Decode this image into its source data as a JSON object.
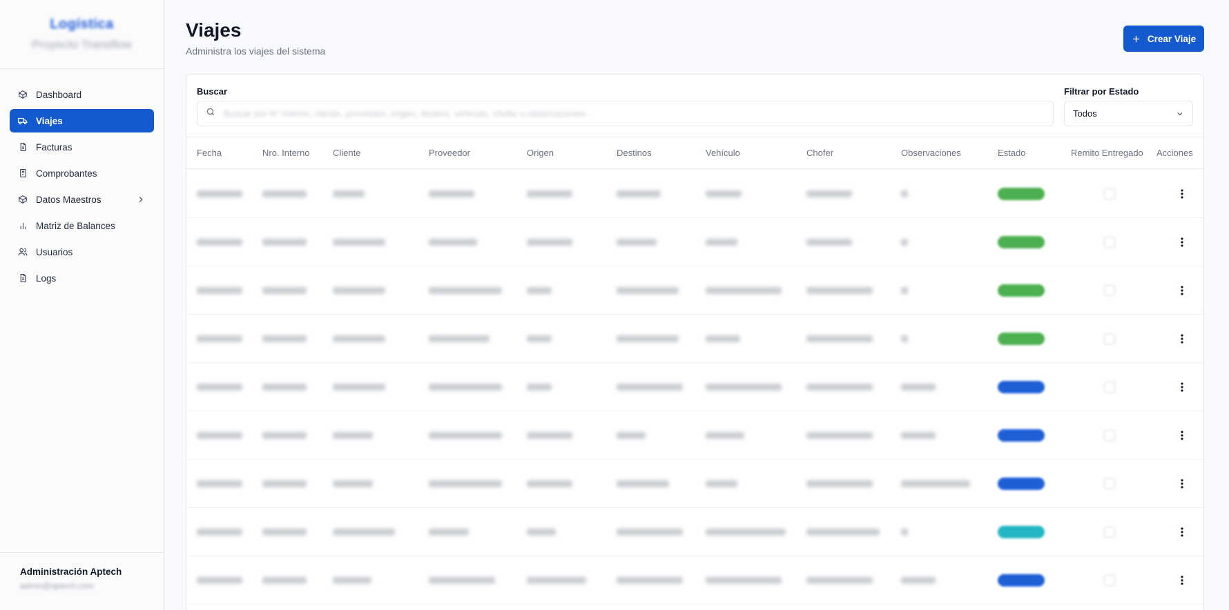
{
  "sidebar": {
    "brand_title": "Logística",
    "brand_subtitle": "Proyecto Transflow",
    "items": [
      {
        "label": "Dashboard",
        "icon": "package-icon"
      },
      {
        "label": "Viajes",
        "icon": "truck-icon",
        "active": true
      },
      {
        "label": "Facturas",
        "icon": "file-icon"
      },
      {
        "label": "Comprobantes",
        "icon": "receipt-icon"
      },
      {
        "label": "Datos Maestros",
        "icon": "database-icon",
        "has_submenu": true
      },
      {
        "label": "Matriz de Balances",
        "icon": "bar-chart-icon"
      },
      {
        "label": "Usuarios",
        "icon": "users-icon"
      },
      {
        "label": "Logs",
        "icon": "file-text-icon"
      }
    ],
    "user": {
      "name": "Administración Aptech",
      "email": "admin@aptech.com"
    }
  },
  "header": {
    "title": "Viajes",
    "subtitle": "Administra los viajes del sistema",
    "create_button": "Crear Viaje"
  },
  "filters": {
    "search_label": "Buscar",
    "search_placeholder": "Buscar por N° interno, cliente, proveedor, origen, destino, vehículo, chofer u observaciones...",
    "state_label": "Filtrar por Estado",
    "state_value": "Todos"
  },
  "table": {
    "columns": [
      "Fecha",
      "Nro. Interno",
      "Cliente",
      "Proveedor",
      "Origen",
      "Destinos",
      "Vehículo",
      "Chofer",
      "Observaciones",
      "Estado",
      "Remito Entregado",
      "Acciones"
    ],
    "row_count": 9
  },
  "colors": {
    "accent": "#1459cf",
    "status_green": "#4caf50",
    "status_blue": "#1e5fd6",
    "status_teal": "#22b5c4"
  }
}
